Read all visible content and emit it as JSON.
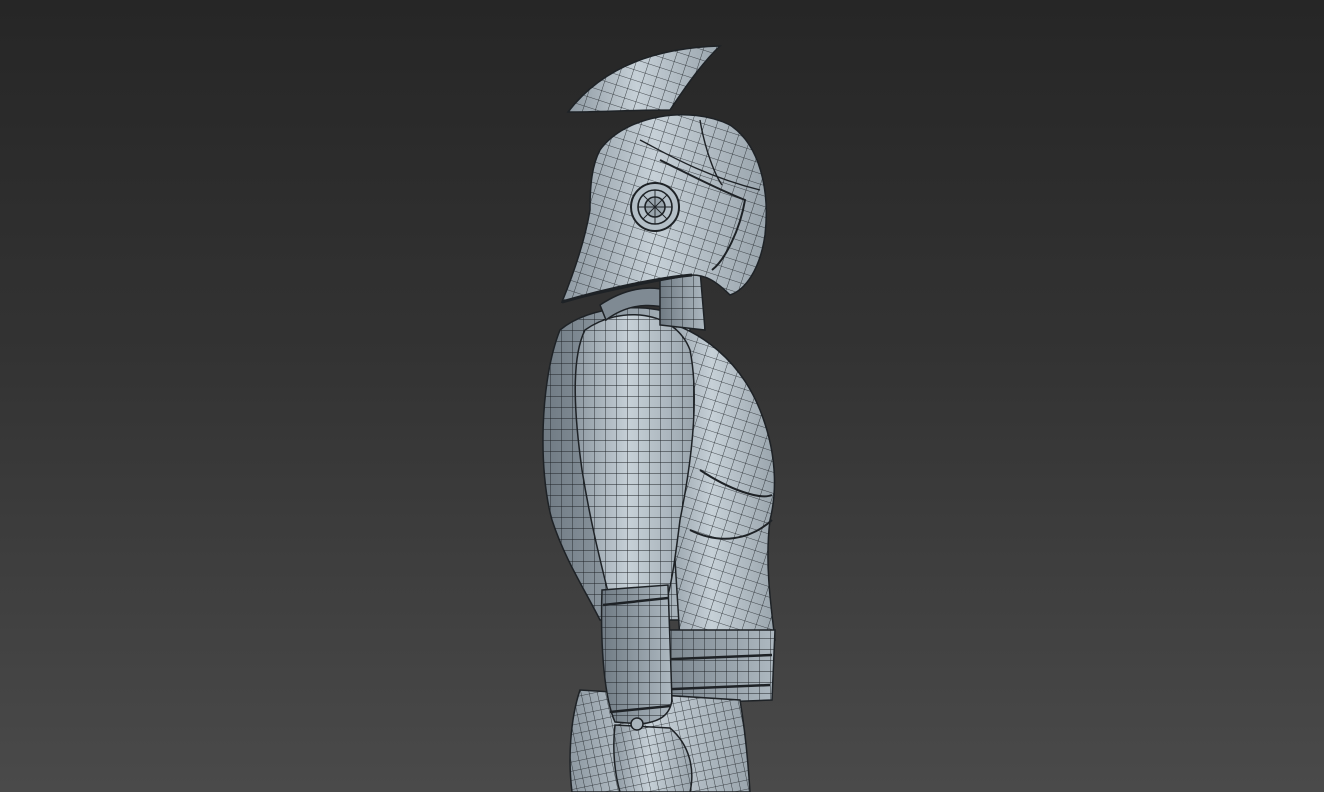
{
  "viewport": {
    "background_top": "#262626",
    "background_bottom": "#4a4a4a",
    "shading_mode": "shaded-with-wireframe",
    "mesh_color": "#b9c4cc",
    "wire_color": "#1e2226"
  },
  "model": {
    "subject": "warrior-figure",
    "view": "side-profile"
  }
}
